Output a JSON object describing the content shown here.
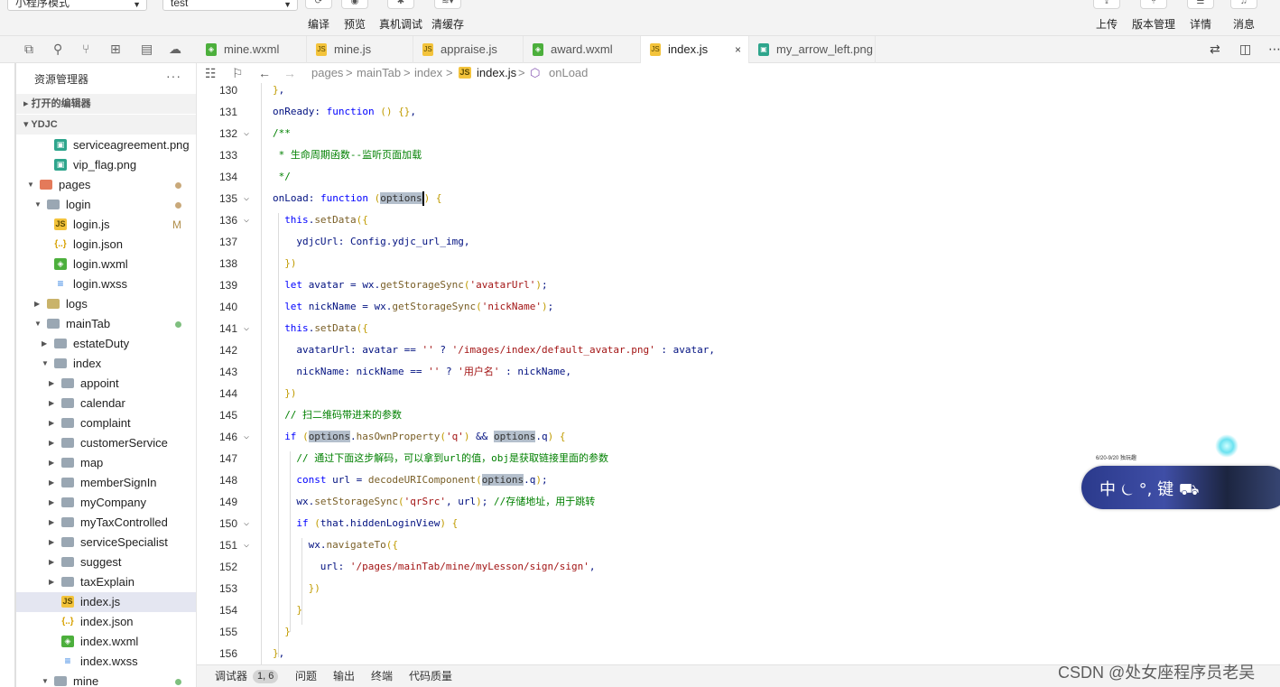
{
  "toolbar": {
    "mode_select": "小程序模式",
    "compile_select": "test",
    "buttons_left": [
      {
        "label": "编译",
        "icon": "refresh-icon"
      },
      {
        "label": "预览",
        "icon": "eye-icon"
      },
      {
        "label": "真机调试",
        "icon": "bug-icon"
      },
      {
        "label": "清缓存",
        "icon": "layers-icon"
      }
    ],
    "buttons_right": [
      {
        "label": "上传",
        "icon": "upload-icon"
      },
      {
        "label": "版本管理",
        "icon": "branch-icon"
      },
      {
        "label": "详情",
        "icon": "menu-icon"
      },
      {
        "label": "消息",
        "icon": "bell-icon"
      }
    ]
  },
  "sidebar": {
    "title": "资源管理器",
    "more": "···",
    "section_open_editors": "打开的编辑器",
    "section_project": "YDJC",
    "items": [
      {
        "name": "serviceagreement.png",
        "type": "png",
        "depth": 3
      },
      {
        "name": "vip_flag.png",
        "type": "png",
        "depth": 3
      },
      {
        "name": "pages",
        "type": "folder-red",
        "depth": 1,
        "expanded": true,
        "dot": "#c9a97a"
      },
      {
        "name": "login",
        "type": "folder",
        "depth": 2,
        "expanded": true,
        "dot": "#c9a97a"
      },
      {
        "name": "login.js",
        "type": "js",
        "depth": 3,
        "badge": "M"
      },
      {
        "name": "login.json",
        "type": "json",
        "depth": 3
      },
      {
        "name": "login.wxml",
        "type": "wxml",
        "depth": 3
      },
      {
        "name": "login.wxss",
        "type": "wxss",
        "depth": 3
      },
      {
        "name": "logs",
        "type": "folder-y",
        "depth": 2,
        "expanded": false
      },
      {
        "name": "mainTab",
        "type": "folder",
        "depth": 2,
        "expanded": true,
        "dot": "#7fbf7f"
      },
      {
        "name": "estateDuty",
        "type": "folder",
        "depth": 3,
        "expanded": false
      },
      {
        "name": "index",
        "type": "folder",
        "depth": 3,
        "expanded": true
      },
      {
        "name": "appoint",
        "type": "folder",
        "depth": 4,
        "expanded": false
      },
      {
        "name": "calendar",
        "type": "folder",
        "depth": 4,
        "expanded": false
      },
      {
        "name": "complaint",
        "type": "folder",
        "depth": 4,
        "expanded": false
      },
      {
        "name": "customerService",
        "type": "folder",
        "depth": 4,
        "expanded": false
      },
      {
        "name": "map",
        "type": "folder",
        "depth": 4,
        "expanded": false
      },
      {
        "name": "memberSignIn",
        "type": "folder",
        "depth": 4,
        "expanded": false
      },
      {
        "name": "myCompany",
        "type": "folder",
        "depth": 4,
        "expanded": false
      },
      {
        "name": "myTaxControlled",
        "type": "folder",
        "depth": 4,
        "expanded": false
      },
      {
        "name": "serviceSpecialist",
        "type": "folder",
        "depth": 4,
        "expanded": false
      },
      {
        "name": "suggest",
        "type": "folder",
        "depth": 4,
        "expanded": false
      },
      {
        "name": "taxExplain",
        "type": "folder",
        "depth": 4,
        "expanded": false
      },
      {
        "name": "index.js",
        "type": "js",
        "depth": 4,
        "selected": true
      },
      {
        "name": "index.json",
        "type": "json",
        "depth": 4
      },
      {
        "name": "index.wxml",
        "type": "wxml",
        "depth": 4
      },
      {
        "name": "index.wxss",
        "type": "wxss",
        "depth": 4
      },
      {
        "name": "mine",
        "type": "folder",
        "depth": 3,
        "expanded": true,
        "dot": "#7fbf7f"
      }
    ]
  },
  "tabs": [
    {
      "label": "mine.wxml",
      "type": "wxml"
    },
    {
      "label": "mine.js",
      "type": "js"
    },
    {
      "label": "appraise.js",
      "type": "js"
    },
    {
      "label": "award.wxml",
      "type": "wxml"
    },
    {
      "label": "index.js",
      "type": "js",
      "active": true,
      "close": "×"
    },
    {
      "label": "my_arrow_left.png",
      "type": "png"
    }
  ],
  "breadcrumb": {
    "segments": [
      "pages",
      "mainTab",
      "index",
      "index.js",
      "onLoad"
    ],
    "separator": ">"
  },
  "editor": {
    "lines": [
      {
        "n": "130",
        "code": "},"
      },
      {
        "n": "131",
        "code": "onReady: function () {},"
      },
      {
        "n": "132",
        "code": "/**",
        "fold": true
      },
      {
        "n": "133",
        "code": " * 生命周期函数--监听页面加载"
      },
      {
        "n": "134",
        "code": " */"
      },
      {
        "n": "135",
        "code": "onLoad: function (options) {",
        "fold": true
      },
      {
        "n": "136",
        "code": "  this.setData({",
        "fold": true
      },
      {
        "n": "137",
        "code": "    ydjcUrl: Config.ydjc_url_img,"
      },
      {
        "n": "138",
        "code": "  })"
      },
      {
        "n": "139",
        "code": "  let avatar = wx.getStorageSync('avatarUrl');"
      },
      {
        "n": "140",
        "code": "  let nickName = wx.getStorageSync('nickName');"
      },
      {
        "n": "141",
        "code": "  this.setData({",
        "fold": true
      },
      {
        "n": "142",
        "code": "    avatarUrl: avatar == '' ? '/images/index/default_avatar.png' : avatar,"
      },
      {
        "n": "143",
        "code": "    nickName: nickName == '' ? '用户名' : nickName,"
      },
      {
        "n": "144",
        "code": "  })"
      },
      {
        "n": "145",
        "code": "  // 扫二维码带进来的参数"
      },
      {
        "n": "146",
        "code": "  if (options.hasOwnProperty('q') && options.q) {",
        "fold": true
      },
      {
        "n": "147",
        "code": "    // 通过下面这步解码，可以拿到url的值，obj是获取链接里面的参数"
      },
      {
        "n": "148",
        "code": "    const url = decodeURIComponent(options.q);"
      },
      {
        "n": "149",
        "code": "    wx.setStorageSync('qrSrc', url); //存储地址，用于跳转"
      },
      {
        "n": "150",
        "code": "    if (that.hiddenLoginView) {",
        "fold": true
      },
      {
        "n": "151",
        "code": "      wx.navigateTo({",
        "fold": true
      },
      {
        "n": "152",
        "code": "        url: '/pages/mainTab/mine/myLesson/sign/sign',"
      },
      {
        "n": "153",
        "code": "      })"
      },
      {
        "n": "154",
        "code": "    }"
      },
      {
        "n": "155",
        "code": "  }"
      },
      {
        "n": "156",
        "code": "},"
      }
    ]
  },
  "widget": {
    "text": "中 ⏾ °, 键 ⛟",
    "small": "6/20-9/20 独玩趣"
  },
  "bottom": {
    "tabs": [
      "调试器",
      "问题",
      "输出",
      "终端",
      "代码质量"
    ],
    "position": "1, 6"
  },
  "watermark": "CSDN @处女座程序员老吴"
}
